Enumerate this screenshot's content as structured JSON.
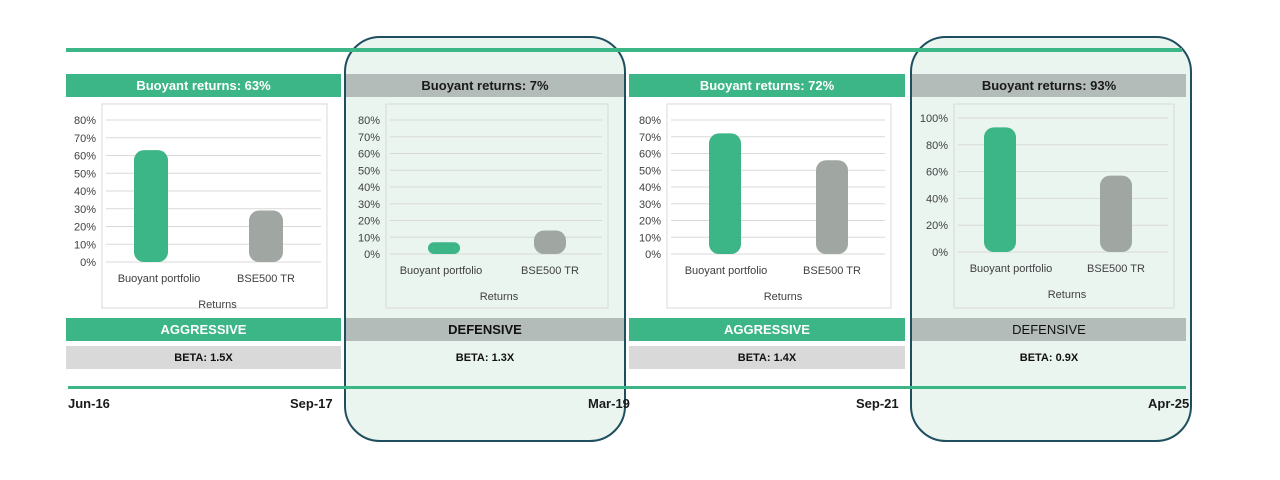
{
  "dates": [
    "Jun-16",
    "Sep-17",
    "Mar-19",
    "Sep-21",
    "Apr-25"
  ],
  "colors": {
    "accent": "#3cb587",
    "grey_bar": "#a0a7a3",
    "grey_header": "#b3bcb8",
    "highlight_border": "#1f4e5f",
    "highlight_fill": "#eaf5f0"
  },
  "chart_data": [
    {
      "type": "bar",
      "title": "Buoyant returns: 63%",
      "categories": [
        "Buoyant portfolio",
        "BSE500 TR"
      ],
      "values": [
        63,
        29
      ],
      "xlabel": "Returns",
      "ylim": [
        0,
        80
      ],
      "yticks": [
        "0%",
        "10%",
        "20%",
        "30%",
        "40%",
        "50%",
        "60%",
        "70%",
        "80%"
      ],
      "regime": "AGGRESSIVE",
      "beta": "BETA: 1.5X"
    },
    {
      "type": "bar",
      "title": "Buoyant returns: 7%",
      "categories": [
        "Buoyant portfolio",
        "BSE500 TR"
      ],
      "values": [
        7,
        14
      ],
      "xlabel": "Returns",
      "ylim": [
        0,
        80
      ],
      "yticks": [
        "0%",
        "10%",
        "20%",
        "30%",
        "40%",
        "50%",
        "60%",
        "70%",
        "80%"
      ],
      "regime": "DEFENSIVE",
      "beta": "BETA: 1.3X"
    },
    {
      "type": "bar",
      "title": "Buoyant returns: 72%",
      "categories": [
        "Buoyant portfolio",
        "BSE500 TR"
      ],
      "values": [
        72,
        56
      ],
      "xlabel": "Returns",
      "ylim": [
        0,
        80
      ],
      "yticks": [
        "0%",
        "10%",
        "20%",
        "30%",
        "40%",
        "50%",
        "60%",
        "70%",
        "80%"
      ],
      "regime": "AGGRESSIVE",
      "beta": "BETA: 1.4X"
    },
    {
      "type": "bar",
      "title": "Buoyant returns: 93%",
      "categories": [
        "Buoyant portfolio",
        "BSE500 TR"
      ],
      "values": [
        93,
        57
      ],
      "xlabel": "Returns",
      "ylim": [
        0,
        100
      ],
      "yticks": [
        "0%",
        "20%",
        "40%",
        "60%",
        "80%",
        "100%"
      ],
      "regime": "DEFENSIVE",
      "beta": "BETA: 0.9X"
    }
  ]
}
